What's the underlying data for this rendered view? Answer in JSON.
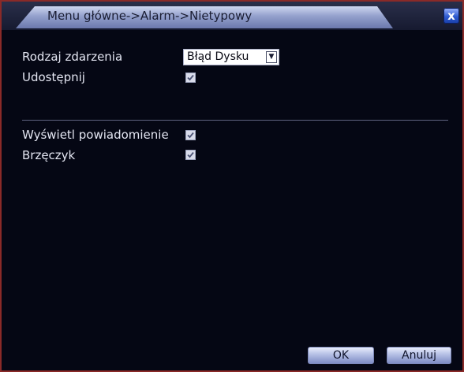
{
  "window": {
    "title": "Menu główne->Alarm->Nietypowy",
    "close_label": "x"
  },
  "form": {
    "event_type_label": "Rodzaj zdarzenia",
    "event_type_value": "Błąd Dysku",
    "enable_label": "Udostępnij",
    "enable_checked": true,
    "show_notification_label": "Wyświetl powiadomienie",
    "show_notification_checked": true,
    "buzzer_label": "Brzęczyk",
    "buzzer_checked": true
  },
  "buttons": {
    "ok_label": "OK",
    "cancel_label": "Anuluj"
  },
  "icons": {
    "close": "close-icon",
    "dropdown": "chevron-down-icon",
    "check": "checkmark-icon"
  },
  "colors": {
    "background": "#050714",
    "title_tab": "#93a0cc",
    "close_button": "#2f5bd1",
    "border": "#8a2a28",
    "text": "#e4e6f2"
  }
}
